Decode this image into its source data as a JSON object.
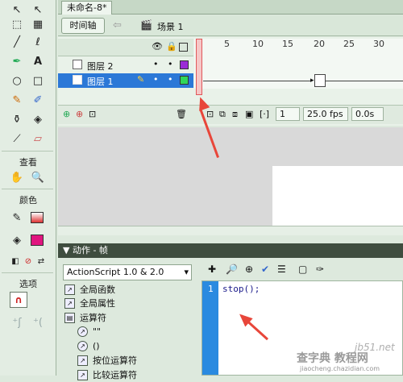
{
  "document_tab": "未命名-8*",
  "scene_bar": {
    "timeline_button": "时间轴",
    "scene_label": "场景 1"
  },
  "timeline": {
    "ruler_numbers": [
      "5",
      "10",
      "15",
      "20",
      "25",
      "30"
    ],
    "layers": [
      {
        "name": "图层 2",
        "selected": false
      },
      {
        "name": "图层 1",
        "selected": true
      }
    ],
    "current_frame": "1",
    "fps": "25.0 fps",
    "elapsed": "0.0s"
  },
  "tools": {
    "view_label": "查看",
    "colors_label": "颜色",
    "options_label": "选项"
  },
  "actions_panel": {
    "title": "动作 - 帧",
    "script_version": "ActionScript 1.0 & 2.0",
    "tree": [
      "全局函数",
      "全局属性",
      "运算符",
      "\"\"",
      "()",
      "按位运算符",
      "比较运算符"
    ],
    "code_line_number": "1",
    "code": "stop();"
  },
  "watermark": {
    "line1": "查字典 教程网",
    "line2": "jiaocheng.chazidian.com",
    "site": "jb51.net"
  }
}
